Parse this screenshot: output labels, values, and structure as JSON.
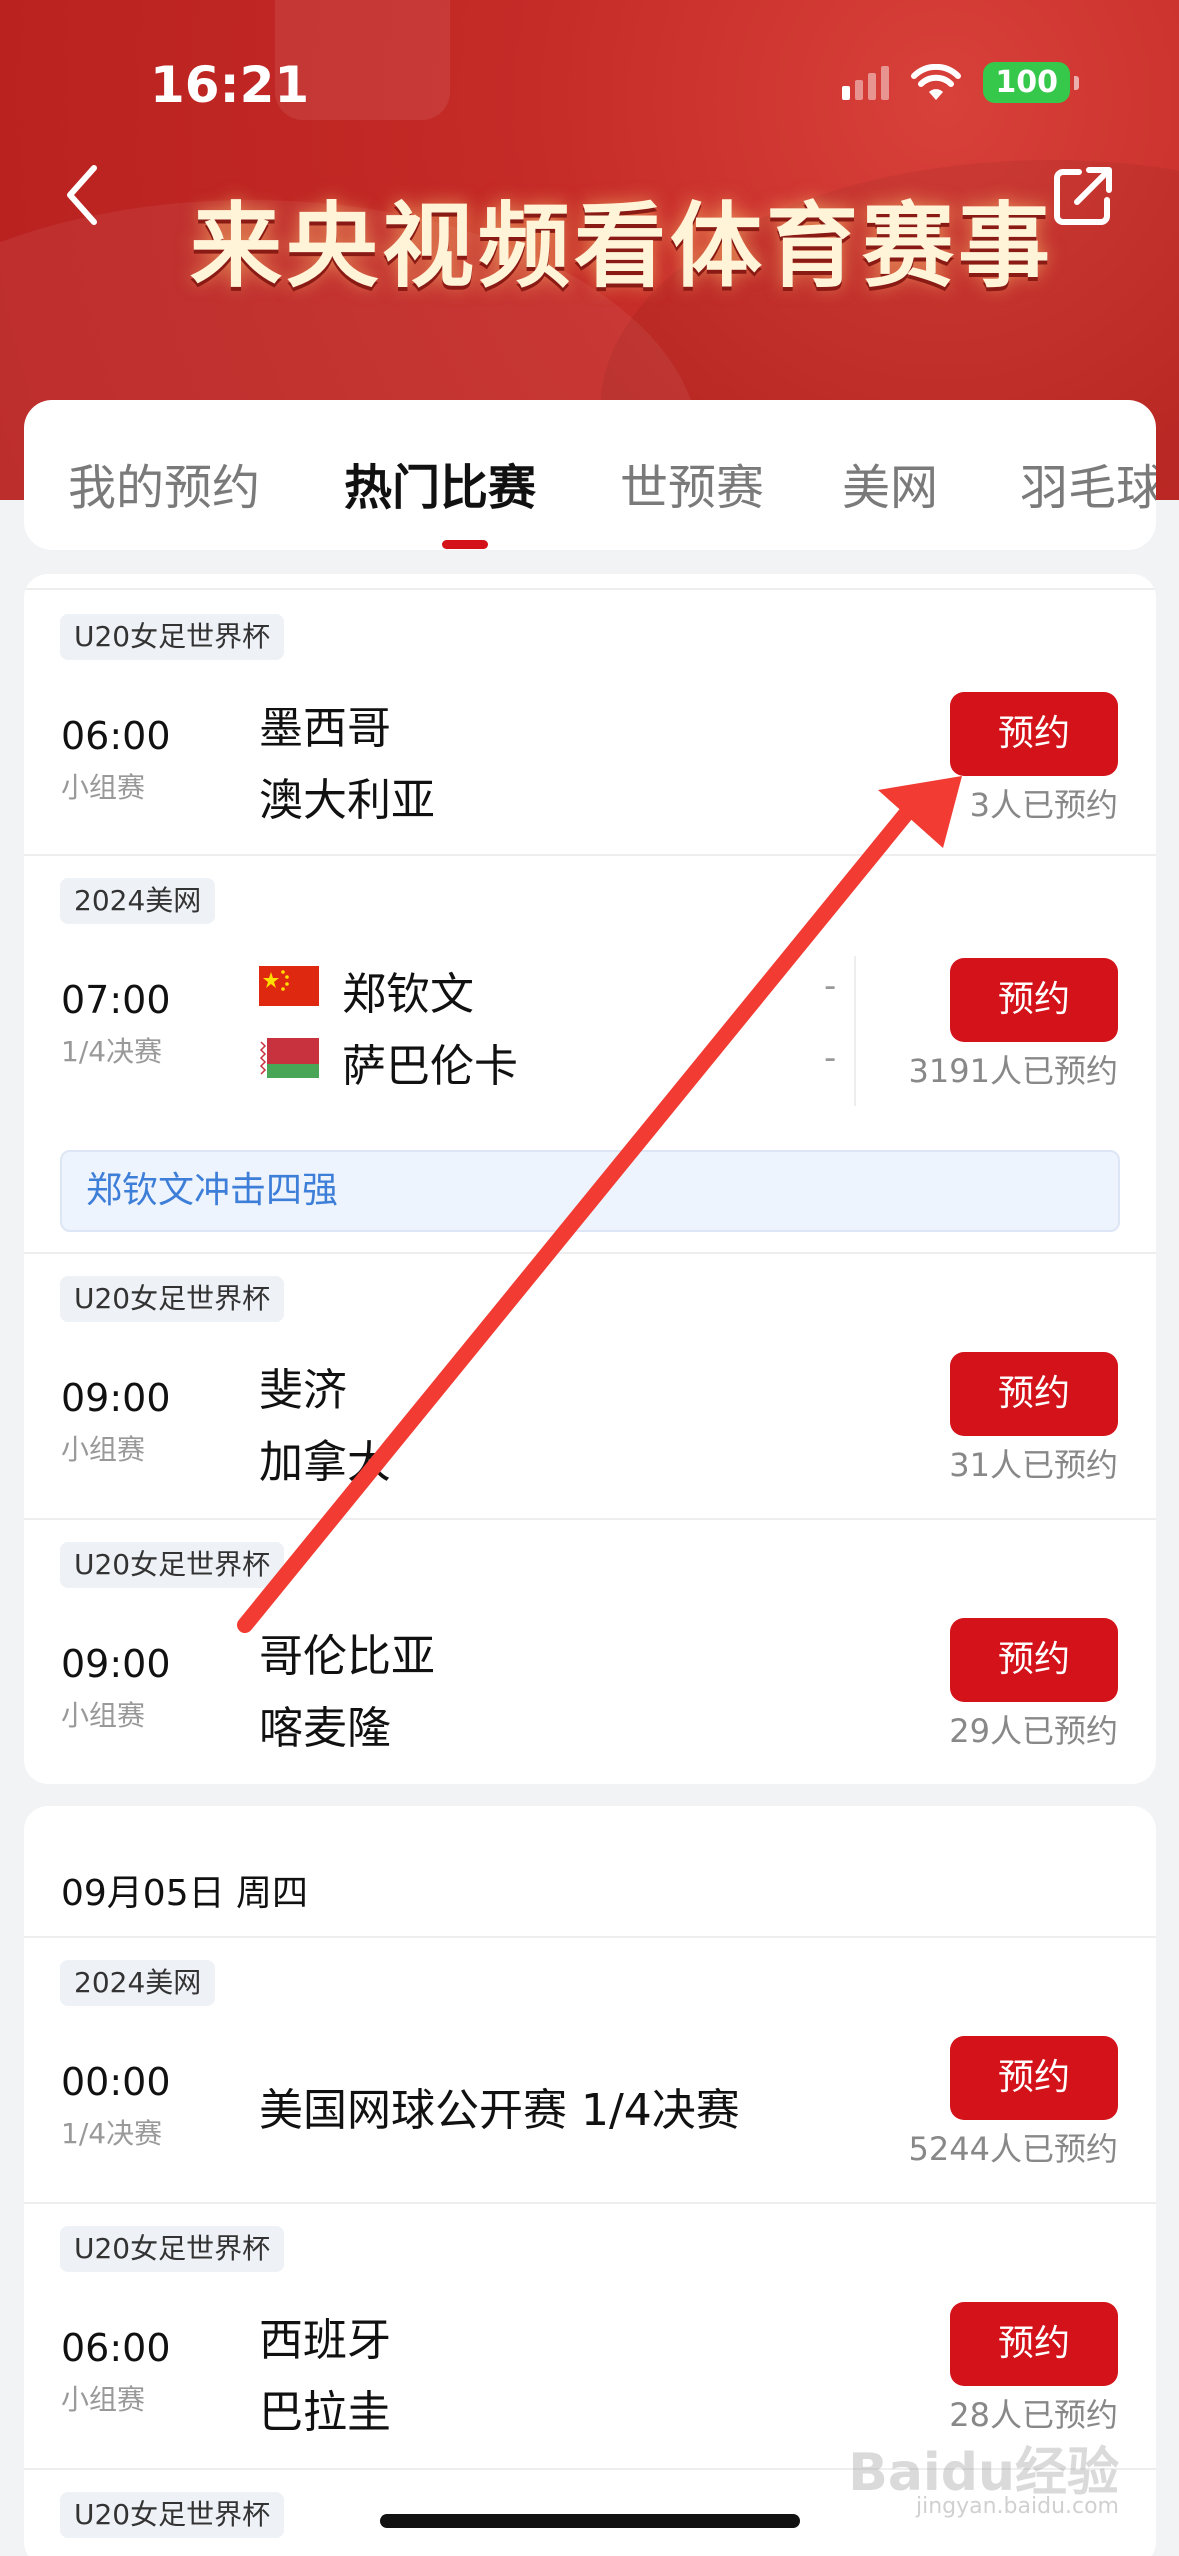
{
  "status": {
    "time": "16:21",
    "battery": "100"
  },
  "header": {
    "title": "来央视频看体育赛事"
  },
  "tabs": [
    "我的预约",
    "热门比赛",
    "世预赛",
    "美网",
    "羽毛球"
  ],
  "card1": {
    "matches": [
      {
        "tag": "U20女足世界杯",
        "time": "06:00",
        "stage": "小组赛",
        "team1": "墨西哥",
        "team2": "澳大利亚",
        "button": "预约",
        "count": "3人已预约"
      },
      {
        "tag": "2024美网",
        "time": "07:00",
        "stage": "1/4决赛",
        "team1": "郑钦文",
        "team2": "萨巴伦卡",
        "score1": "-",
        "score2": "-",
        "button": "预约",
        "count": "3191人已预约",
        "tip": "郑钦文冲击四强"
      },
      {
        "tag": "U20女足世界杯",
        "time": "09:00",
        "stage": "小组赛",
        "team1": "斐济",
        "team2": "加拿大",
        "button": "预约",
        "count": "31人已预约"
      },
      {
        "tag": "U20女足世界杯",
        "time": "09:00",
        "stage": "小组赛",
        "team1": "哥伦比亚",
        "team2": "喀麦隆",
        "button": "预约",
        "count": "29人已预约"
      }
    ]
  },
  "card2": {
    "date": "09月05日 周四",
    "matches": [
      {
        "tag": "2024美网",
        "time": "00:00",
        "stage": "1/4决赛",
        "title": "美国网球公开赛 1/4决赛",
        "button": "预约",
        "count": "5244人已预约"
      },
      {
        "tag": "U20女足世界杯",
        "time": "06:00",
        "stage": "小组赛",
        "team1": "西班牙",
        "team2": "巴拉圭",
        "button": "预约",
        "count": "28人已预约"
      },
      {
        "tag": "U20女足世界杯"
      }
    ]
  },
  "watermark": {
    "text": "Baidu经验",
    "sub": "jingyan.baidu.com"
  },
  "colors": {
    "accent": "#d4121a",
    "header": "#c52b27",
    "link": "#3d7ed8",
    "arrow": "#f23b32"
  },
  "icons": [
    "back-icon",
    "share-icon",
    "signal-icon",
    "wifi-icon",
    "battery-icon",
    "china-flag-icon",
    "belarus-flag-icon"
  ]
}
